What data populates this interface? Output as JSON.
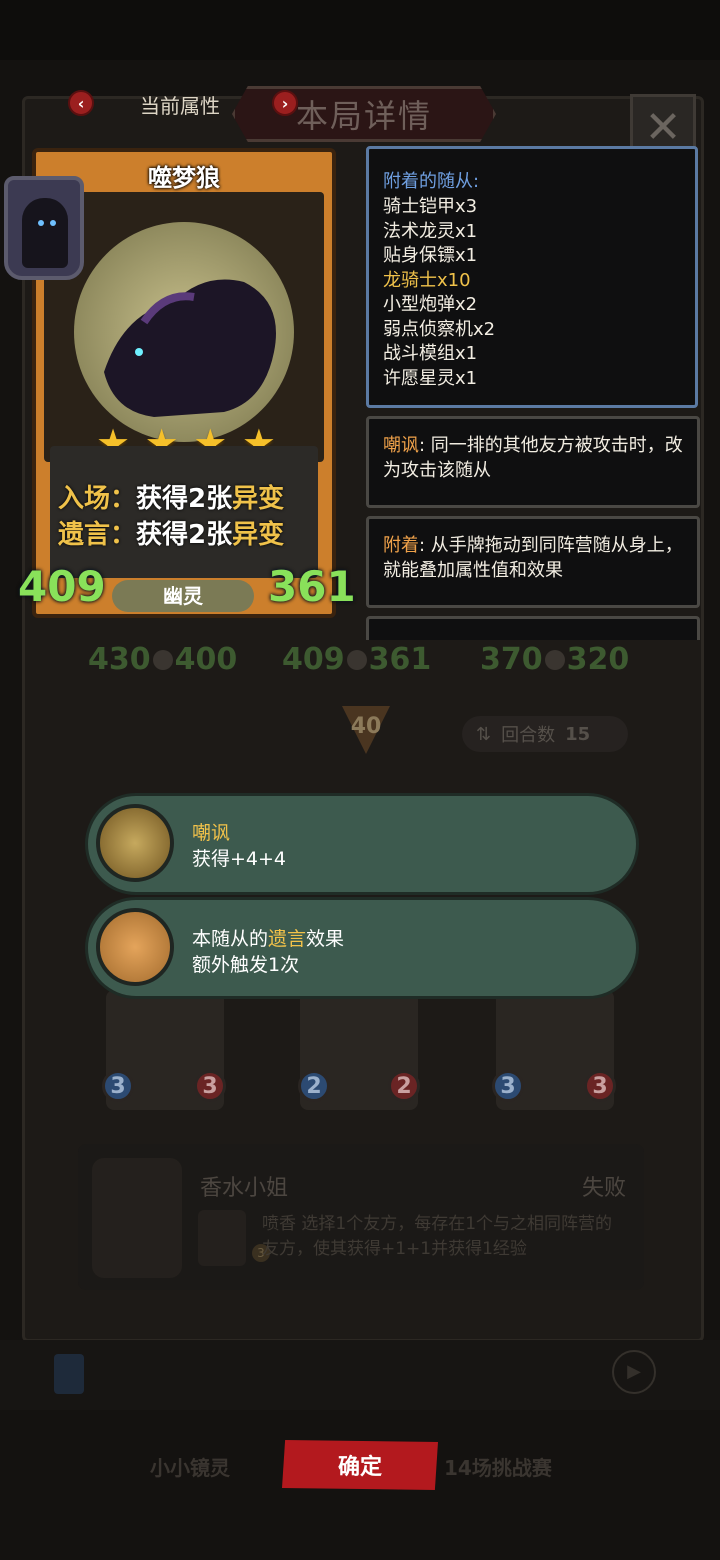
{
  "header": {
    "current_attr_label": "当前属性",
    "title": "本局详情",
    "prev_icon": "chevron-left-icon",
    "next_icon": "chevron-right-icon",
    "close_icon": "close-icon"
  },
  "card": {
    "name": "噬梦狼",
    "stars": 4,
    "effect1_label": "入场：",
    "effect1_text": "获得2张",
    "effect1_kw": "异变",
    "effect2_label": "遗言：",
    "effect2_text": "获得2张",
    "effect2_kw": "异变",
    "type": "幽灵",
    "attack": "409",
    "health": "361"
  },
  "attached": {
    "title": "附着的随从:",
    "items": [
      {
        "text": "骑士铠甲x3",
        "highlight": false
      },
      {
        "text": "法术龙灵x1",
        "highlight": false
      },
      {
        "text": "贴身保镖x1",
        "highlight": false
      },
      {
        "text": "龙骑士x10",
        "highlight": true
      },
      {
        "text": "小型炮弹x2",
        "highlight": false
      },
      {
        "text": "弱点侦察机x2",
        "highlight": false
      },
      {
        "text": "战斗模组x1",
        "highlight": false
      },
      {
        "text": "许愿星灵x1",
        "highlight": false
      }
    ]
  },
  "keywords": [
    {
      "name": "嘲讽",
      "sep": ": ",
      "desc": "同一排的其他友方被攻击时，改为攻击该随从"
    },
    {
      "name": "附着",
      "sep": ": ",
      "desc": "从手牌拖动到同阵营随从身上，就能叠加属性值和效果"
    }
  ],
  "board": {
    "stats": [
      {
        "atk": "430",
        "hp": "400"
      },
      {
        "atk": "409",
        "hp": "361"
      },
      {
        "atk": "370",
        "hp": "320"
      }
    ],
    "arrow_value": "40",
    "rounds_label": "回合数",
    "rounds_value": "15",
    "mini_cards": [
      {
        "atk": "3",
        "hp": "3"
      },
      {
        "atk": "2",
        "hp": "2"
      },
      {
        "atk": "3",
        "hp": "3"
      }
    ]
  },
  "popup": {
    "taunt_title": "嘲讽",
    "taunt_desc": "获得+4+4",
    "lastword_prefix": "本随从的",
    "lastword_kw": "遗言",
    "lastword_suffix": "效果",
    "lastword_line2": "额外触发1次"
  },
  "log": {
    "name": "香水小姐",
    "result": "失败",
    "desc": "喷香 选择1个友方，每存在1个与之相同阵营的友方，使其获得+1+1并获得1经验",
    "badge": "3"
  },
  "footer": {
    "left_tab": "小小镜灵",
    "confirm": "确定",
    "right_tab": "14场挑战赛"
  },
  "colors": {
    "accent_red": "#b3191e",
    "card_orange": "#cc7f2c",
    "keyword_gold": "#f0c24a",
    "stat_green": "#89e15a",
    "popup_green": "#3d5a4e",
    "attached_blue": "#6f9fe0"
  }
}
